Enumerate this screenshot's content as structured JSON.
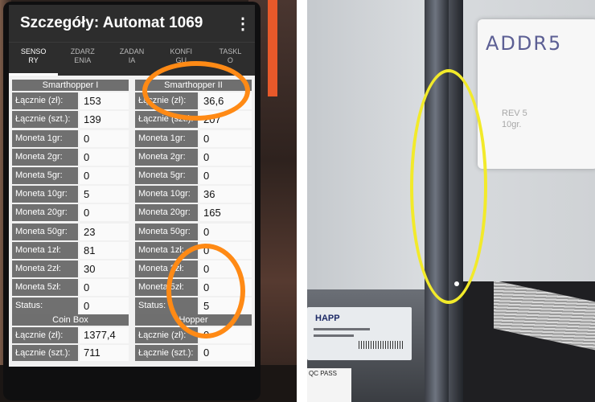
{
  "app": {
    "title": "Szczegóły: Automat 1069",
    "menu_icon": "more-vert-icon"
  },
  "tabs": [
    {
      "label": "SENSO\nRY",
      "active": true
    },
    {
      "label": "ZDARZ\nENIA",
      "active": false
    },
    {
      "label": "ZADAN\nIA",
      "active": false
    },
    {
      "label": "KONFI\nGU",
      "active": false
    },
    {
      "label": "TASKL\nO",
      "active": false
    }
  ],
  "smarthopper1": {
    "title": "Smarthopper I",
    "rows": [
      {
        "label": "Łącznie (zł):",
        "value": "153"
      },
      {
        "label": "Łącznie (szt.):",
        "value": "139"
      },
      {
        "label": "Moneta 1gr:",
        "value": "0"
      },
      {
        "label": "Moneta 2gr:",
        "value": "0"
      },
      {
        "label": "Moneta 5gr:",
        "value": "0"
      },
      {
        "label": "Moneta 10gr:",
        "value": "5"
      },
      {
        "label": "Moneta 20gr:",
        "value": "0"
      },
      {
        "label": "Moneta 50gr:",
        "value": "23"
      },
      {
        "label": "Moneta 1zł:",
        "value": "81"
      },
      {
        "label": "Moneta 2zł:",
        "value": "30"
      },
      {
        "label": "Moneta 5zł:",
        "value": "0"
      },
      {
        "label": "Status:",
        "value": "0"
      }
    ]
  },
  "smarthopper2": {
    "title": "Smarthopper II",
    "rows": [
      {
        "label": "Łącznie (zł):",
        "value": "36,6"
      },
      {
        "label": "Łącznie (szt.):",
        "value": "207"
      },
      {
        "label": "Moneta 1gr:",
        "value": "0"
      },
      {
        "label": "Moneta 2gr:",
        "value": "0"
      },
      {
        "label": "Moneta 5gr:",
        "value": "0"
      },
      {
        "label": "Moneta 10gr:",
        "value": "36"
      },
      {
        "label": "Moneta 20gr:",
        "value": "165"
      },
      {
        "label": "Moneta 50gr:",
        "value": "0"
      },
      {
        "label": "Moneta 1zł:",
        "value": "0"
      },
      {
        "label": "Moneta 2zł:",
        "value": "0"
      },
      {
        "label": "Moneta 5zł:",
        "value": "0"
      },
      {
        "label": "Status:",
        "value": "5"
      }
    ]
  },
  "coinbox": {
    "title": "Coin Box",
    "rows": [
      {
        "label": "Łącznie (zł):",
        "value": "1377,4"
      },
      {
        "label": "Łącznie (szt.):",
        "value": "711"
      }
    ]
  },
  "hopper": {
    "title": "Hopper",
    "rows": [
      {
        "label": "Łącznie (zł):",
        "value": "0"
      },
      {
        "label": "Łącznie (szt.):",
        "value": "0"
      }
    ]
  },
  "right_photo": {
    "label_card_text": "ADDR5",
    "label_card_faint": "REV 5\n10gr.",
    "sticker_brand": "HAPP",
    "pass_text": "QC PASS"
  },
  "colors": {
    "annotation_orange": "#ff8a15",
    "annotation_yellow": "#f2ea2a",
    "appbar": "#2d2d2d",
    "label_bg": "#707070"
  }
}
